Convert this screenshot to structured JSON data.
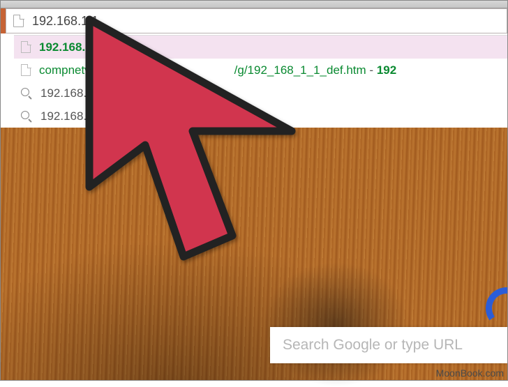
{
  "address_bar": {
    "value": "192.168.1.1"
  },
  "suggestions": [
    {
      "kind": "page",
      "highlighted": true,
      "parts": [
        {
          "cls": "green-bold",
          "text": "192.168.1.1"
        }
      ]
    },
    {
      "kind": "page",
      "highlighted": false,
      "parts": [
        {
          "cls": "green",
          "text": "compnetworki"
        },
        {
          "cls": "green",
          "text": "                                     "
        },
        {
          "cls": "green",
          "text": "/g/192_168_1_1_def.htm"
        },
        {
          "cls": "dark",
          "text": " - "
        },
        {
          "cls": "green-bold",
          "text": "192"
        }
      ]
    },
    {
      "kind": "search",
      "highlighted": false,
      "parts": [
        {
          "cls": "dark",
          "text": "192.168.1.1 - G"
        }
      ]
    },
    {
      "kind": "search",
      "highlighted": false,
      "parts": [
        {
          "cls": "dark",
          "text": "192.168.1.1"
        },
        {
          "cls": "dark-bold",
          "text": "0.8888"
        }
      ]
    }
  ],
  "search_box": {
    "placeholder": "Search Google or type URL"
  },
  "watermark": "MoonBook.com"
}
